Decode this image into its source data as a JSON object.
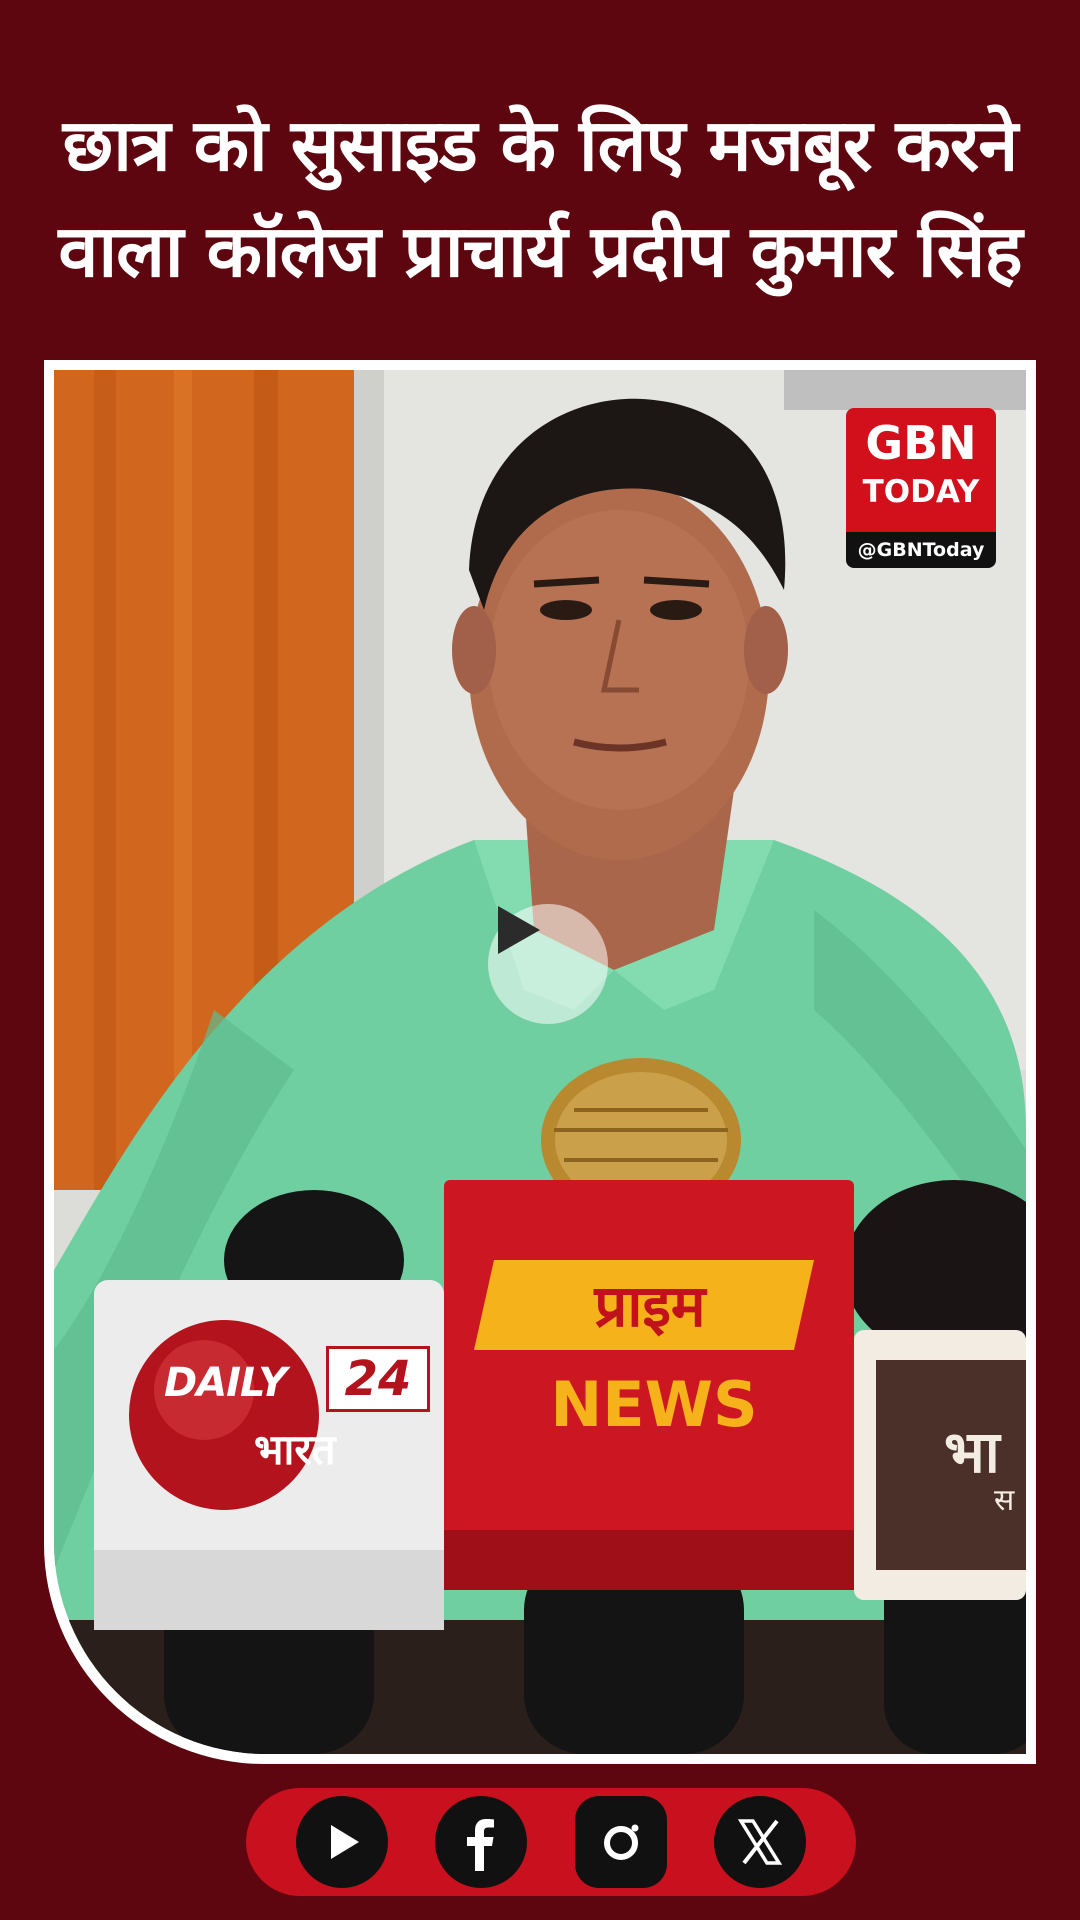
{
  "headline": {
    "line1": "छात्र को सुसाइड के लिए मजबूर करने",
    "line2": "वाला कॉलेज प्राचार्य प्रदीप कुमार सिंह"
  },
  "logo": {
    "name": "GBN",
    "sub": "TODAY",
    "handle": "@GBNToday"
  },
  "video": {
    "mic_labels": {
      "daily": "DAILY",
      "daily_num": "24",
      "daily_sub": "भारत",
      "prime": "प्राइम",
      "news": "NEWS",
      "right_partial": "भा",
      "right_partial2": "स"
    },
    "play_icon": "play-icon"
  },
  "social": [
    {
      "name": "youtube",
      "icon": "play-icon"
    },
    {
      "name": "facebook",
      "icon": "facebook-icon"
    },
    {
      "name": "instagram",
      "icon": "instagram-icon"
    },
    {
      "name": "x",
      "icon": "x-icon"
    }
  ],
  "colors": {
    "background": "#5e0610",
    "accent": "#c9101e",
    "logo_red": "#d1101c"
  }
}
